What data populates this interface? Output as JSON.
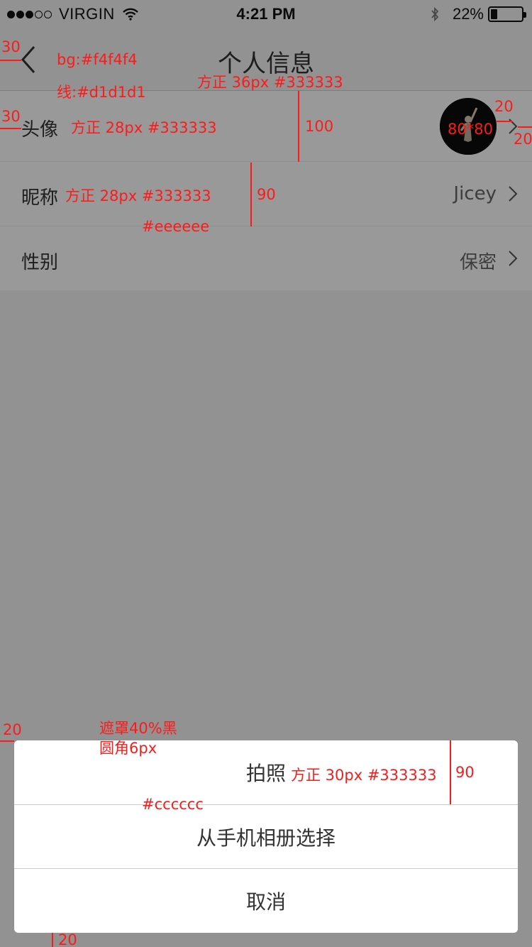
{
  "status_bar": {
    "carrier": "VIRGIN",
    "time": "4:21 PM",
    "battery_text": "22%",
    "battery_level": 0.22,
    "signal_full": 3,
    "signal_total": 5
  },
  "nav": {
    "title": "个人信息",
    "back_icon": "chevron-left-icon"
  },
  "profile": {
    "rows": [
      {
        "label": "头像",
        "value": ""
      },
      {
        "label": "昵称",
        "value": "Jicey"
      },
      {
        "label": "性别",
        "value": "保密"
      }
    ]
  },
  "action_sheet": {
    "options": [
      "拍照",
      "从手机相册选择",
      "取消"
    ]
  },
  "annotations": {
    "back_margin": "30",
    "bg": "bg:#f4f4f4",
    "line": "线:#d1d1d1",
    "title_font": "方正 36px #333333",
    "avatar_margin": "30",
    "avatar_label_font": "方正 28px #333333",
    "avatar_row_height": "100",
    "avatar_size": "80*80",
    "avatar_gap": "20",
    "chevron_margin": "20",
    "nickname_font": "方正 28px #333333",
    "nickname_row_height": "90",
    "row_line": "#eeeeee",
    "sheet_margin": "20",
    "mask": "遮罩40%黑",
    "radius": "圆角6px",
    "sheet_font": "方正 30px #333333",
    "sheet_row_height": "90",
    "sheet_line": "#cccccc",
    "sheet_bottom": "20"
  },
  "colors": {
    "background": "#f4f4f4",
    "nav_line": "#d1d1d1",
    "row_line": "#eeeeee",
    "text": "#333333",
    "sheet_line": "#cccccc",
    "annotation": "#ff1a1a"
  }
}
